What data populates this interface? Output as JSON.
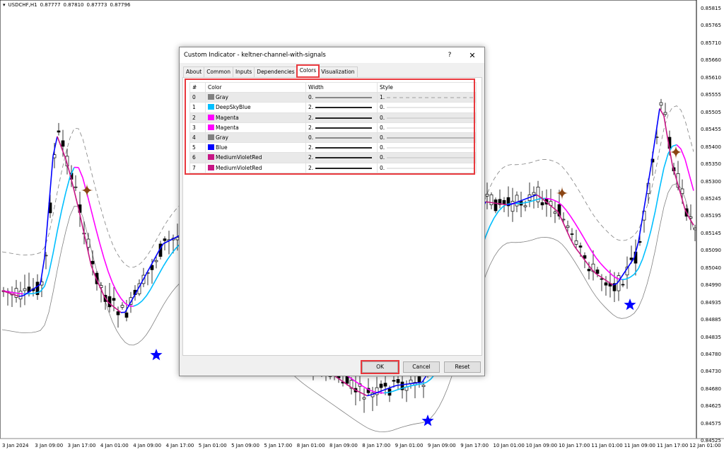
{
  "chart": {
    "symbol": "USDCHF,H1",
    "ohlc": [
      "0.87777",
      "0.87810",
      "0.87773",
      "0.87796"
    ],
    "price_labels": [
      "0.85815",
      "0.85765",
      "0.85710",
      "0.85660",
      "0.85610",
      "0.85555",
      "0.85505",
      "0.85455",
      "0.85400",
      "0.85350",
      "0.85300",
      "0.85245",
      "0.85195",
      "0.85145",
      "0.85090",
      "0.85040",
      "0.84990",
      "0.84935",
      "0.84885",
      "0.84835",
      "0.84780",
      "0.84730",
      "0.84680",
      "0.84625",
      "0.84575",
      "0.84525"
    ],
    "time_labels": [
      "3 Jan 2024",
      "3 Jan 09:00",
      "3 Jan 17:00",
      "4 Jan 01:00",
      "4 Jan 09:00",
      "4 Jan 17:00",
      "5 Jan 01:00",
      "5 Jan 09:00",
      "5 Jan 17:00",
      "8 Jan 01:00",
      "8 Jan 09:00",
      "8 Jan 17:00",
      "9 Jan 01:00",
      "9 Jan 09:00",
      "9 Jan 17:00",
      "10 Jan 01:00",
      "10 Jan 09:00",
      "10 Jan 17:00",
      "11 Jan 01:00",
      "11 Jan 09:00",
      "11 Jan 17:00",
      "12 Jan 01:00"
    ],
    "colors": {
      "band": "#808080",
      "slow_up": "#00bfff",
      "slow_down": "#ff00ff",
      "fast_up": "#0000ff",
      "fast_down": "#c71585",
      "buy_star": "#0000ff",
      "sell_diamond": "#8b4513"
    }
  },
  "dialog": {
    "title": "Custom Indicator - keltner-channel-with-signals",
    "help": "?",
    "close": "✕",
    "tabs": [
      "About",
      "Common",
      "Inputs",
      "Dependencies",
      "Colors",
      "Visualization"
    ],
    "active_tab": "Colors",
    "columns": [
      "#",
      "Color",
      "Width",
      "Style"
    ],
    "rows": [
      {
        "idx": "0",
        "name": "Gray",
        "hex": "#808080",
        "width": "0.",
        "style": "1."
      },
      {
        "idx": "1",
        "name": "DeepSkyBlue",
        "hex": "#00bfff",
        "width": "2.",
        "style": "0."
      },
      {
        "idx": "2",
        "name": "Magenta",
        "hex": "#ff00ff",
        "width": "2.",
        "style": "0."
      },
      {
        "idx": "3",
        "name": "Magenta",
        "hex": "#ff00ff",
        "width": "2.",
        "style": "0."
      },
      {
        "idx": "4",
        "name": "Gray",
        "hex": "#808080",
        "width": "0.",
        "style": "0."
      },
      {
        "idx": "5",
        "name": "Blue",
        "hex": "#0000ff",
        "width": "2.",
        "style": "0."
      },
      {
        "idx": "6",
        "name": "MediumVioletRed",
        "hex": "#c71585",
        "width": "2.",
        "style": "0."
      },
      {
        "idx": "7",
        "name": "MediumVioletRed",
        "hex": "#c71585",
        "width": "2.",
        "style": "0."
      }
    ],
    "buttons": {
      "ok": "OK",
      "cancel": "Cancel",
      "reset": "Reset"
    }
  }
}
